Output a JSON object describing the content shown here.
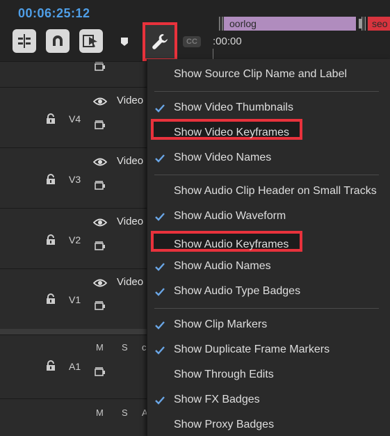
{
  "header": {
    "timecode": "00:06:25:12",
    "ruler_time": ":00:00",
    "cc_label": "CC",
    "clips": [
      {
        "label": "oorlog",
        "color": "#b08cbe"
      },
      {
        "label": "seo",
        "color": "#d8343e"
      }
    ],
    "toolbar_icons": [
      "insert-sequence-icon",
      "snap-magnet-icon",
      "linked-selection-icon",
      "add-marker-icon",
      "wrench-settings-icon",
      "captions-icon"
    ]
  },
  "tracks": [
    {
      "name": "V4",
      "clip_label": "Video"
    },
    {
      "name": "V3",
      "clip_label": "Video"
    },
    {
      "name": "V2",
      "clip_label": "Video"
    },
    {
      "name": "V1",
      "clip_label": "Video"
    },
    {
      "name": "A1",
      "mute": "M",
      "solo": "S",
      "extra": "c"
    },
    {
      "name": "",
      "mute": "M",
      "solo": "S",
      "extra": "A"
    }
  ],
  "menu": {
    "items": [
      {
        "label": "Show Source Clip Name and Label",
        "checked": false
      },
      {
        "label": "Show Video Thumbnails",
        "checked": true
      },
      {
        "label": "Show Video Keyframes",
        "checked": false,
        "highlighted": true
      },
      {
        "label": "Show Video Names",
        "checked": true
      },
      {
        "label": "Show Audio Clip Header on Small Tracks",
        "checked": false
      },
      {
        "label": "Show Audio Waveform",
        "checked": true
      },
      {
        "label": "Show Audio Keyframes",
        "checked": false,
        "highlighted": true
      },
      {
        "label": "Show Audio Names",
        "checked": true
      },
      {
        "label": "Show Audio Type Badges",
        "checked": true
      },
      {
        "label": "Show Clip Markers",
        "checked": true
      },
      {
        "label": "Show Duplicate Frame Markers",
        "checked": true
      },
      {
        "label": "Show Through Edits",
        "checked": false
      },
      {
        "label": "Show FX Badges",
        "checked": true
      },
      {
        "label": "Show Proxy Badges",
        "checked": false
      }
    ]
  },
  "colors": {
    "accent_blue": "#4f9fe8",
    "highlight_red": "#e8323c",
    "check_blue": "#6aa6e6"
  }
}
